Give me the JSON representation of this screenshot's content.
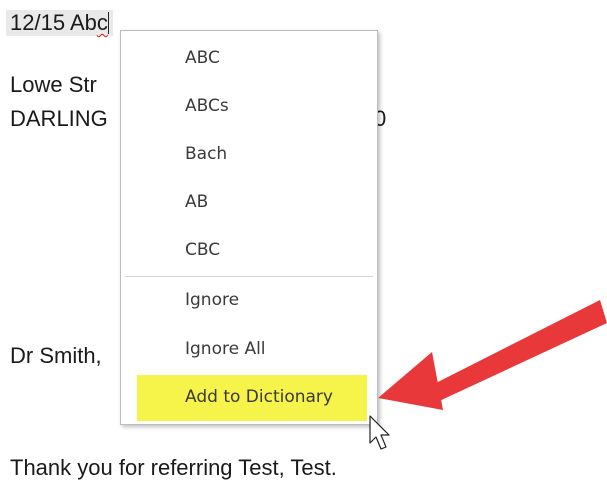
{
  "document": {
    "line1_prefix": "12/15 Ab",
    "line1_suffix": "c",
    "line2": "Lowe Str",
    "line3": "DARLING",
    "line3_end": "0",
    "line4": "Dr Smith,",
    "line5": "Thank you for referring Test, Test."
  },
  "context_menu": {
    "suggestions": [
      "ABC",
      "ABCs",
      "Bach",
      "AB",
      "CBC"
    ],
    "ignore": "Ignore",
    "ignore_all": "Ignore All",
    "add_to_dictionary": "Add to Dictionary"
  },
  "colors": {
    "highlight": "#f6f34a",
    "arrow": "#e8383a"
  },
  "icons": {
    "arrow": "red-arrow-icon",
    "cursor": "mouse-pointer-icon"
  }
}
